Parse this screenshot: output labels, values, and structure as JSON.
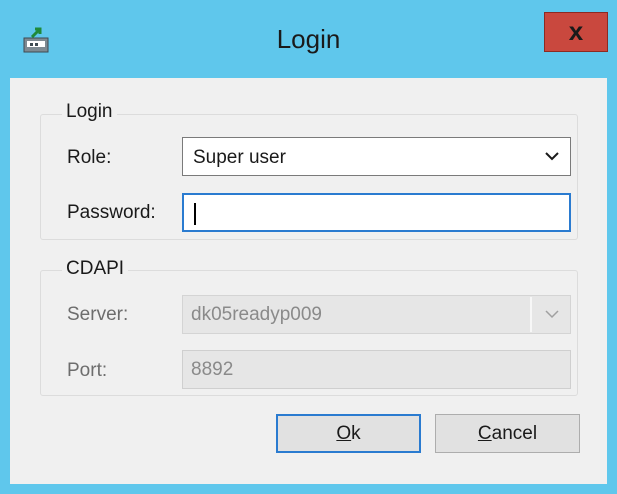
{
  "window": {
    "title": "Login",
    "close_label": "x",
    "icon": "app-icon"
  },
  "login_group": {
    "legend": "Login",
    "role_label": "Role:",
    "role_value": "Super user",
    "password_label": "Password:",
    "password_value": ""
  },
  "cdapi_group": {
    "legend": "CDAPI",
    "server_label": "Server:",
    "server_value": "dk05readyp009",
    "port_label": "Port:",
    "port_value": "8892"
  },
  "buttons": {
    "ok_mnemonic": "O",
    "ok_rest": "k",
    "cancel_mnemonic": "C",
    "cancel_rest": "ancel"
  },
  "colors": {
    "titlebar": "#5fc7ec",
    "close_button": "#c9483e",
    "focus_border": "#2a7bd0",
    "client_bg": "#f0f0f0"
  }
}
